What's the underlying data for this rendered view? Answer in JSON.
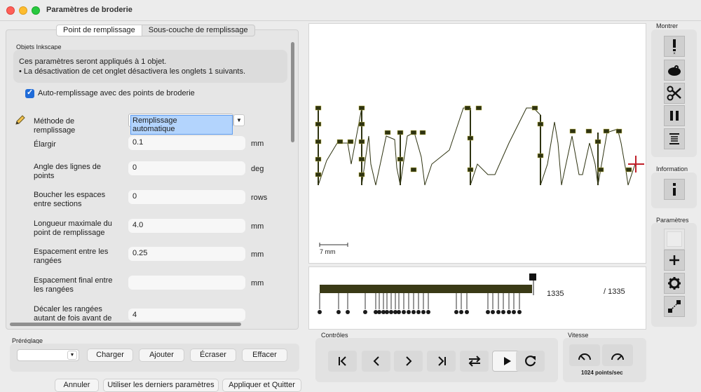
{
  "window": {
    "title": "Paramètres de broderie"
  },
  "tabs": [
    "Point de remplissage",
    "Sous-couche de remplissage"
  ],
  "objects_group": {
    "label": "Objets Inkscape",
    "info_line1": "Ces paramètres seront appliqués à 1 objet.",
    "info_line2": "• La désactivation de cet onglet désactivera les onglets 1 suivants."
  },
  "autofill": {
    "label": "Auto-remplissage avec des points de broderie",
    "checked": true
  },
  "fill_method": {
    "label": "Méthode de remplissage",
    "value": "Remplissage automatique"
  },
  "params": [
    {
      "label": "Élargir",
      "value": "0.1",
      "unit": "mm"
    },
    {
      "label": "Angle des lignes de points",
      "value": "0",
      "unit": "deg"
    },
    {
      "label": "Boucher les espaces entre sections",
      "value": "0",
      "unit": "rows"
    },
    {
      "label": "Longueur maximale du point de remplissage",
      "value": "4.0",
      "unit": "mm"
    },
    {
      "label": "Espacement entre les rangées",
      "value": "0.25",
      "unit": "mm"
    },
    {
      "label": "Espacement final entre les rangées",
      "value": "",
      "unit": "mm"
    },
    {
      "label": "Décaler les rangées autant de fois avant de",
      "value": "4",
      "unit": ""
    }
  ],
  "preset": {
    "label": "Préréglage",
    "buttons": [
      "Charger",
      "Ajouter",
      "Écraser",
      "Effacer"
    ]
  },
  "footer": {
    "cancel": "Annuler",
    "use_last": "Utiliser les derniers paramètres",
    "apply_quit": "Appliquer et Quitter"
  },
  "canvas": {
    "scale_label": "7 mm"
  },
  "timeline": {
    "current": "1335",
    "total": "/ 1335"
  },
  "controls": {
    "label": "Contrôles"
  },
  "speed": {
    "label": "Vitesse",
    "value": "1024 points/sec"
  },
  "sidebar": {
    "show_label": "Montrer",
    "info_label": "Information",
    "params_label": "Paramètres"
  },
  "colors": {
    "accent": "#1f6bd8",
    "stitch": "#2e3311"
  }
}
